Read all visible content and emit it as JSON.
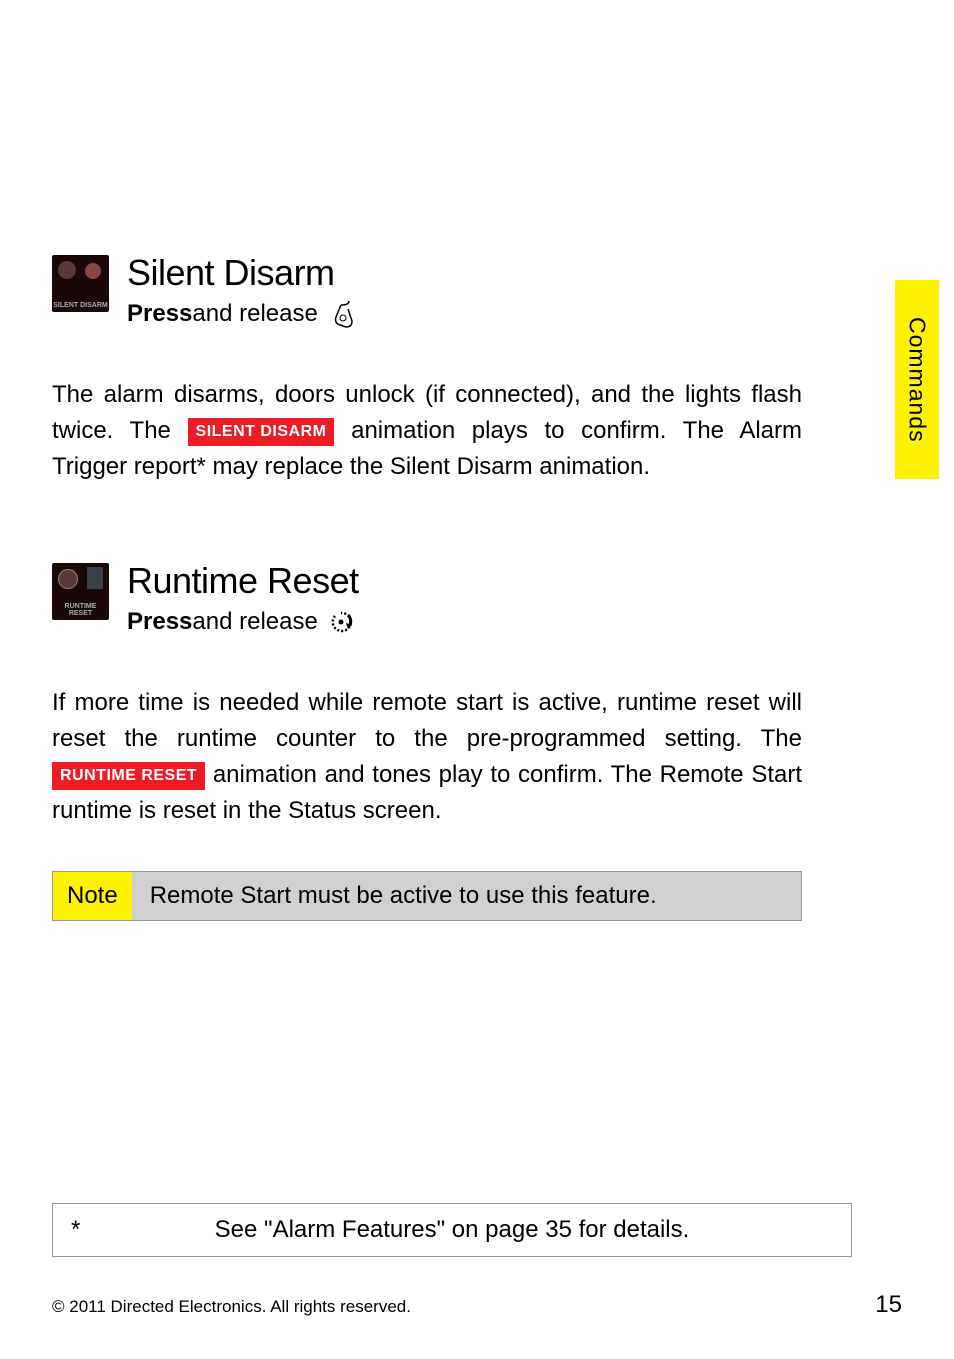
{
  "sideTab": "Commands",
  "sections": {
    "silentDisarm": {
      "iconLabel": "SILENT DISARM",
      "title": "Silent Disarm",
      "pressLabel": "Press",
      "andRelease": " and release ",
      "bodyPart1": "The alarm disarms, doors unlock (if connected), and the lights flash twice. The ",
      "badge": "SILENT DISARM",
      "bodyPart2": " animation plays to confirm. The Alarm Trigger report* may replace the Silent Disarm animation."
    },
    "runtimeReset": {
      "iconLabel": "RUNTIME RESET",
      "title": "Runtime Reset",
      "pressLabel": "Press",
      "andRelease": " and release ",
      "bodyPart1": "If more time is needed while remote start is active, runtime reset will reset the runtime counter to the pre-programmed setting. The ",
      "badge": "RUNTIME RESET",
      "bodyPart2": " animation and tones play to confirm. The Remote Start runtime is reset in the Status screen."
    }
  },
  "note": {
    "label": "Note",
    "text": "Remote Start must be active to use this feature."
  },
  "footnote": {
    "asterisk": "*",
    "text": "See \"Alarm Features\" on page 35 for details."
  },
  "footer": {
    "copyright": "© 2011 Directed Electronics. All rights reserved.",
    "pageNumber": "15"
  }
}
